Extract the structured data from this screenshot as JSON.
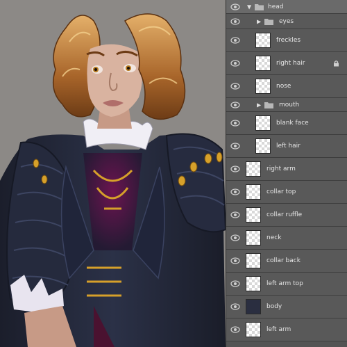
{
  "layers_panel": {
    "layers": [
      {
        "label": "head",
        "type": "group",
        "expanded": true,
        "indent": 0
      },
      {
        "label": "eyes",
        "type": "group",
        "expanded": false,
        "indent": 1
      },
      {
        "label": "freckles",
        "type": "layer",
        "indent": 1
      },
      {
        "label": "right hair",
        "type": "layer",
        "indent": 1,
        "locked": true
      },
      {
        "label": "nose",
        "type": "layer",
        "indent": 1
      },
      {
        "label": "mouth",
        "type": "group",
        "expanded": false,
        "indent": 1
      },
      {
        "label": "blank face",
        "type": "layer",
        "indent": 1
      },
      {
        "label": "left hair",
        "type": "layer",
        "indent": 1
      },
      {
        "label": "right arm",
        "type": "layer",
        "indent": 0
      },
      {
        "label": "collar top",
        "type": "layer",
        "indent": 0
      },
      {
        "label": "collar ruffle",
        "type": "layer",
        "indent": 0
      },
      {
        "label": "neck",
        "type": "layer",
        "indent": 0
      },
      {
        "label": "collar back",
        "type": "layer",
        "indent": 0
      },
      {
        "label": "left arm top",
        "type": "layer",
        "indent": 0
      },
      {
        "label": "body",
        "type": "layer",
        "indent": 0
      },
      {
        "label": "left arm",
        "type": "layer",
        "indent": 0
      }
    ]
  },
  "colors": {
    "canvas_bg": "#8c8986",
    "panel_bg": "#535353",
    "coat": "#23273a",
    "hair": "#b97a33",
    "skin": "#d9b3a0",
    "gold": "#d6a02a",
    "vest": "#5a1a3a"
  }
}
